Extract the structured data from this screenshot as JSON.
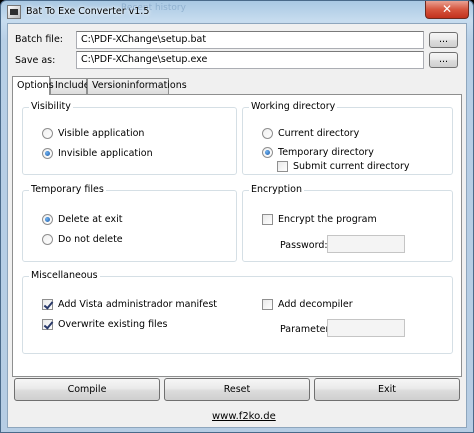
{
  "window": {
    "title": "Bat To Exe Converter v1.5",
    "close_glyph": "✕",
    "background_watermark": "Recent history"
  },
  "files": {
    "batch_label": "Batch file:",
    "batch_value": "C:\\PDF-XChange\\setup.bat",
    "save_label": "Save as:",
    "save_value": "C:\\PDF-XChange\\setup.exe",
    "browse_label": "..."
  },
  "tabs": [
    {
      "label": "Options",
      "active": true
    },
    {
      "label": "Include",
      "active": false
    },
    {
      "label": "Versioninformations",
      "active": false
    }
  ],
  "visibility": {
    "title": "Visibility",
    "visible_label": "Visible application",
    "invisible_label": "Invisible application",
    "selected": "invisible"
  },
  "working_dir": {
    "title": "Working directory",
    "current_label": "Current directory",
    "temporary_label": "Temporary directory",
    "submit_label": "Submit current directory",
    "selected": "temporary",
    "submit_checked": false
  },
  "temp_files": {
    "title": "Temporary files",
    "delete_label": "Delete at exit",
    "keep_label": "Do not delete",
    "selected": "delete"
  },
  "encryption": {
    "title": "Encryption",
    "encrypt_label": "Encrypt the program",
    "encrypt_checked": false,
    "password_label": "Password:",
    "password_value": ""
  },
  "misc": {
    "title": "Miscellaneous",
    "vista_label": "Add Vista administrador manifest",
    "vista_checked": true,
    "overwrite_label": "Overwrite existing files",
    "overwrite_checked": true,
    "decompiler_label": "Add decompiler",
    "decompiler_checked": false,
    "parameter_label": "Parameter:",
    "parameter_value": ""
  },
  "actions": {
    "compile_label": "Compile",
    "reset_label": "Reset",
    "exit_label": "Exit"
  },
  "footer": {
    "link_text": "www.f2ko.de"
  }
}
